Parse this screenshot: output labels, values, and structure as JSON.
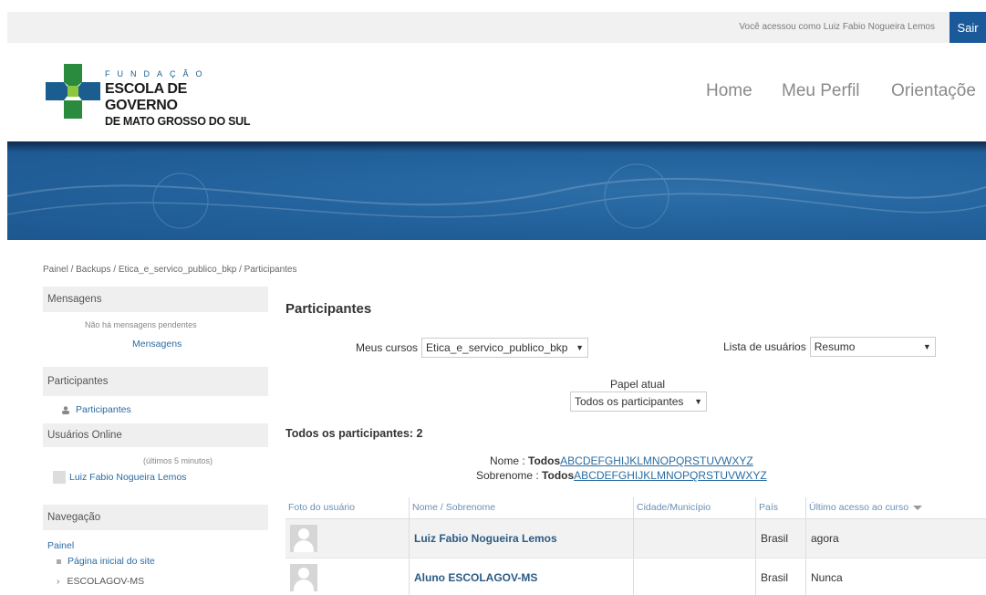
{
  "topbar": {
    "user_info": "Você acessou como Luiz Fabio Nogueira Lemos",
    "logout": "Sair"
  },
  "logo": {
    "line1": "FUNDAÇÃO",
    "line2": "ESCOLA DE GOVERNO",
    "line3": "DE MATO GROSSO DO SUL"
  },
  "nav": {
    "home": "Home",
    "profile": "Meu Perfil",
    "guidance": "Orientaçõe"
  },
  "breadcrumb": "Painel / Backups / Etica_e_servico_publico_bkp / Participantes",
  "sidebar": {
    "messages": {
      "title": "Mensagens",
      "empty": "Não há mensagens pendentes",
      "link": "Mensagens"
    },
    "participants": {
      "title": "Participantes",
      "link": "Participantes"
    },
    "online": {
      "title": "Usuários Online",
      "note": "(últimos 5 minutos)",
      "user": "Luiz Fabio Nogueira Lemos"
    },
    "navigation": {
      "title": "Navegação",
      "painel": "Painel",
      "home_page": "Página inicial do site",
      "escolagov": "ESCOLAGOV-MS"
    }
  },
  "main": {
    "title": "Participantes",
    "my_courses_label": "Meus cursos",
    "my_courses_value": "Etica_e_servico_publico_bkp",
    "user_list_label": "Lista de usuários",
    "user_list_value": "Resumo",
    "role_label": "Papel atual",
    "role_value": "Todos os participantes",
    "summary": "Todos os participantes: 2",
    "firstname_label": "Nome : ",
    "lastname_label": "Sobrenome : ",
    "all": "Todos",
    "letters": [
      "A",
      "B",
      "C",
      "D",
      "E",
      "F",
      "G",
      "H",
      "I",
      "J",
      "K",
      "L",
      "M",
      "N",
      "O",
      "P",
      "Q",
      "R",
      "S",
      "T",
      "U",
      "V",
      "W",
      "X",
      "Y",
      "Z"
    ]
  },
  "table": {
    "headers": [
      "Foto do usuário",
      "Nome / Sobrenome",
      "Cidade/Município",
      "País",
      "Último acesso ao curso"
    ],
    "rows": [
      {
        "name": "Luiz Fabio Nogueira Lemos",
        "city": "",
        "country": "Brasil",
        "last_access": "agora"
      },
      {
        "name": "Aluno ESCOLAGOV-MS",
        "city": "",
        "country": "Brasil",
        "last_access": "Nunca"
      }
    ]
  },
  "colors": {
    "accent": "#1a5a9b",
    "link": "#2b6ca3",
    "banner": "#24649f"
  }
}
